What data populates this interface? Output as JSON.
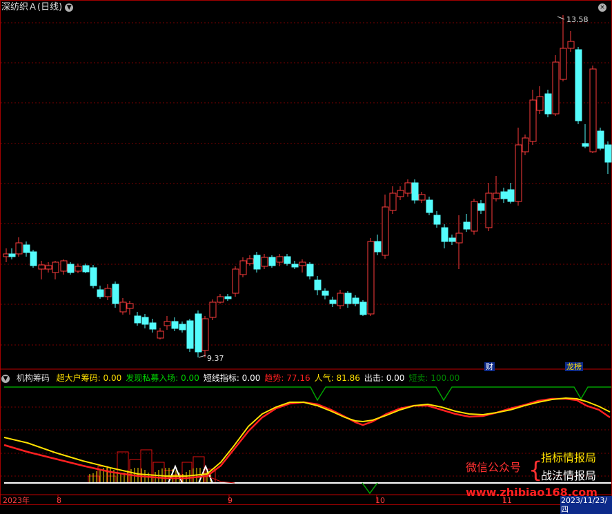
{
  "header": {
    "title": "深纺织Ａ(日线)",
    "icon": "chevron-down-icon",
    "settings_icon": "close-circle-icon"
  },
  "price": {
    "high_label": "13.58",
    "low_label": "9.37"
  },
  "indicator": {
    "name": "机构筹码",
    "items": [
      {
        "label": "超大户筹码: 0.00",
        "color": "#ffe000"
      },
      {
        "label": "发现私募入场: 0.00",
        "color": "#00d000"
      },
      {
        "label": "短线指标: 0.00",
        "color": "#ffffff"
      },
      {
        "label": "趋势: 77.16",
        "color": "#ff2020"
      },
      {
        "label": "人气: 81.86",
        "color": "#ffe000"
      },
      {
        "label": "出击: 0.00",
        "color": "#ffffff"
      },
      {
        "label": "短卖: 100.00",
        "color": "#008800"
      }
    ]
  },
  "tags": {
    "cai": "财",
    "longhu": "龙榜"
  },
  "watermark": {
    "line1": "微信公众号",
    "brace": "{",
    "line2": "指标情报局",
    "line3": "战法情报局",
    "url": "www.zhibiao168.com"
  },
  "x_axis": {
    "year": "2023年",
    "m8": "8",
    "m9": "9",
    "m10": "10",
    "m11": "11",
    "cursor_date": "2023/11/23/四"
  },
  "colors": {
    "up": "#ff3c3c",
    "down": "#54fcfc",
    "grid": "#7a0000",
    "trend": "#ff2020",
    "popularity": "#ffe000",
    "short_sell": "#00a000"
  }
}
